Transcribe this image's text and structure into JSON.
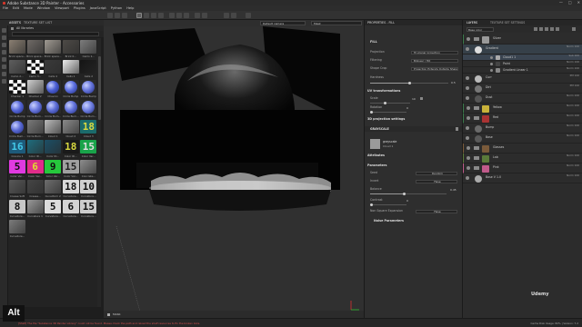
{
  "window": {
    "title": "Adobe Substance 3D Painter - Accessories",
    "controls": [
      "—",
      "□",
      "✕"
    ]
  },
  "menu": [
    "File",
    "Edit",
    "Mode",
    "Window",
    "Viewport",
    "Plugins",
    "JavaScript",
    "Python",
    "Help"
  ],
  "shelf": {
    "tabs": [
      "ASSETS",
      "TEXTURE SET LIST"
    ],
    "library": "All libraries",
    "items": [
      {
        "label": "Brick space...",
        "kind": "mat",
        "bg": "#8a7f72"
      },
      {
        "label": "Brick space...",
        "kind": "mat",
        "bg": "#6f6a66"
      },
      {
        "label": "Brick space...",
        "kind": "mat",
        "bg": "#a09a92"
      },
      {
        "label": "Brick 0...",
        "kind": "mat",
        "bg": "#4d4a46"
      },
      {
        "label": "Camo 1...",
        "kind": "mat",
        "bg": "#7d7d7d"
      },
      {
        "label": "Camo 2...",
        "kind": "mat",
        "bg": "#5e5e5e"
      },
      {
        "label": "Camo 3...",
        "kind": "checker",
        "bg": "#ffffff"
      },
      {
        "label": "Cells 4",
        "kind": "mat",
        "bg": "#3a3a3a"
      },
      {
        "label": "Cells 1",
        "kind": "mat",
        "bg": "#ededed"
      },
      {
        "label": "Cells 2",
        "kind": "mat",
        "bg": "#151515"
      },
      {
        "label": "Checker 1",
        "kind": "checker",
        "bg": "#ffffff"
      },
      {
        "label": "Checker 2",
        "kind": "mat",
        "bg": "#cfcfcf"
      },
      {
        "label": "Chevron",
        "kind": "ball",
        "bg": "#4b5fd4"
      },
      {
        "label": "Circle Bump",
        "kind": "ball",
        "bg": "#5c6fe0"
      },
      {
        "label": "Circle Bump",
        "kind": "ball",
        "bg": "#6675dc"
      },
      {
        "label": "Circle Bump",
        "kind": "ball",
        "bg": "#5667d8"
      },
      {
        "label": "Circle Bum...",
        "kind": "ball",
        "bg": "#6a78de"
      },
      {
        "label": "Circle Bum...",
        "kind": "ball",
        "bg": "#5e6ed6"
      },
      {
        "label": "Circle Bum...",
        "kind": "ball",
        "bg": "#6474dc"
      },
      {
        "label": "Circle Bum...",
        "kind": "ball",
        "bg": "#7080e2"
      },
      {
        "label": "Circle Bum...",
        "kind": "ball",
        "bg": "#5a6ad4"
      },
      {
        "label": "Circle Bum...",
        "kind": "mat",
        "bg": "#7a7a7a"
      },
      {
        "label": "Cloud 1",
        "kind": "mat",
        "bg": "#bbbbbb"
      },
      {
        "label": "Cloud 2",
        "kind": "mat",
        "bg": "#8b8b8b"
      },
      {
        "label": "Cloud 3",
        "kind": "num",
        "bg": "#1b6b6b",
        "num": "18",
        "fg": "#d9d940"
      },
      {
        "label": "Crevice 1",
        "kind": "num",
        "bg": "#1d5a7a",
        "num": "16",
        "fg": "#42c8e8"
      },
      {
        "label": "Color ID...",
        "kind": "mat",
        "bg": "#1f6d7f"
      },
      {
        "label": "Color ID...",
        "kind": "mat",
        "bg": "#1c4f66"
      },
      {
        "label": "Color ID...",
        "kind": "num",
        "bg": "#1a1a1a",
        "num": "18",
        "fg": "#d9d940"
      },
      {
        "label": "Color Var...",
        "kind": "num",
        "bg": "#19a34a",
        "num": "15",
        "fg": "#e0e0e0"
      },
      {
        "label": "Color Var...",
        "kind": "num",
        "bg": "#e03ae0",
        "num": "5",
        "fg": "#111111"
      },
      {
        "label": "Color Var...",
        "kind": "num",
        "bg": "#e02c8a",
        "num": "6",
        "fg": "#dddd30"
      },
      {
        "label": "Color Var...",
        "kind": "num",
        "bg": "#26c83c",
        "num": "9",
        "fg": "#111111"
      },
      {
        "label": "Color Var...",
        "kind": "num",
        "bg": "#a0a0a0",
        "num": "15",
        "fg": "#222222"
      },
      {
        "label": "Concrete...",
        "kind": "mat",
        "bg": "#8e8e8e"
      },
      {
        "label": "Crease Soft",
        "kind": "mat",
        "bg": "#585858"
      },
      {
        "label": "Crease...",
        "kind": "mat",
        "bg": "#454545"
      },
      {
        "label": "Cuneiform 2",
        "kind": "mat",
        "bg": "#6e6e6e"
      },
      {
        "label": "Curvature...",
        "kind": "num",
        "bg": "#d8d8d8",
        "num": "18",
        "fg": "#111111"
      },
      {
        "label": "Curvature...",
        "kind": "num",
        "bg": "#d0d0d0",
        "num": "10",
        "fg": "#111111"
      },
      {
        "label": "Curvature...",
        "kind": "num",
        "bg": "#c8c8c8",
        "num": "8",
        "fg": "#111111"
      },
      {
        "label": "Curvature 1",
        "kind": "mat",
        "bg": "#9a9a9a"
      },
      {
        "label": "Curvature...",
        "kind": "num",
        "bg": "#dcdcdc",
        "num": "5",
        "fg": "#111111"
      },
      {
        "label": "Curvature...",
        "kind": "num",
        "bg": "#d4d4d4",
        "num": "6",
        "fg": "#111111"
      },
      {
        "label": "Curvature...",
        "kind": "num",
        "bg": "#cccccc",
        "num": "15",
        "fg": "#111111"
      },
      {
        "label": "Curvature...",
        "kind": "mat",
        "bg": "#7c7c7c"
      }
    ]
  },
  "viewport": {
    "camera": "Default camera",
    "mode": "Mask",
    "bottom_label": "MASK"
  },
  "properties": {
    "title": "PROPERTIES - FILL",
    "fill_header": "FILL",
    "rows": [
      {
        "label": "Projection",
        "value": "Tri-planar projection"
      },
      {
        "label": "Filtering",
        "value": "Bilinear | HQ"
      },
      {
        "label": "Shape Crop",
        "value": "Projection Extends Outside Shape"
      }
    ],
    "hardness_label": "Hardness",
    "hardness_value": "0.5",
    "hardness": 0.5,
    "uv_header": "UV transformations",
    "scale_label": "Scale",
    "scale_value": "10",
    "rotation_label": "Rotation",
    "rotation_value": "0",
    "proj3d_header": "3D projection settings",
    "grayscale_header": "GRAYSCALE",
    "grayscale_name": "grayscale",
    "grayscale_res": "Cloud 1",
    "attributes_header": "Attributes",
    "parameters_header": "Parameters",
    "params": [
      {
        "label": "Seed",
        "value": "Random"
      },
      {
        "label": "Invert",
        "value": "False"
      }
    ],
    "balance_label": "Balance",
    "balance_value": "0.45",
    "balance": 0.45,
    "contrast_label": "Contrast",
    "contrast_value": "0",
    "nonsquare_label": "Non Square Expansion",
    "nonsquare_value": "False",
    "noise_header": "Noise Parameters"
  },
  "layers": {
    "tabs": [
      "LAYERS",
      "TEXTURE SET SETTINGS"
    ],
    "channel": "Base color",
    "rows": [
      {
        "name": "Silver",
        "blend": "",
        "thumb": "#999999",
        "kind": "folder",
        "color": "#3a7a4a"
      },
      {
        "name": "Gradient",
        "blend": "Norm  100",
        "thumb": "#dddddd",
        "kind": "layer",
        "selected": true
      },
      {
        "name": "Cloud1 1",
        "blend": "Sub  100",
        "thumb": "#aaaaaa",
        "kind": "sub",
        "selected": true
      },
      {
        "name": "Paint",
        "blend": "Norm  100",
        "thumb": "#444444",
        "kind": "sub"
      },
      {
        "name": "Gradient Linear 1",
        "blend": "Norm  100",
        "thumb": "#888888",
        "kind": "sub"
      },
      {
        "name": "Curr",
        "blend": "PM  100",
        "thumb": "#bbbbbb",
        "kind": "layer"
      },
      {
        "name": "Dirt",
        "blend": "PM  100",
        "thumb": "#777777",
        "kind": "layer"
      },
      {
        "name": "Dust",
        "blend": "Norm  100",
        "thumb": "#555555",
        "kind": "layer"
      },
      {
        "name": "Yellow",
        "blend": "Norm  100",
        "thumb": "#c9b23a",
        "kind": "folder",
        "color": "#3a7a4a"
      },
      {
        "name": "Red",
        "blend": "Norm  100",
        "thumb": "#aa3333",
        "kind": "folder",
        "color": "#3a7a4a"
      },
      {
        "name": "Bump",
        "blend": "Norm  100",
        "thumb": "#6a6a6a",
        "kind": "layer"
      },
      {
        "name": "Base",
        "blend": "Norm  100",
        "thumb": "#5a5a5a",
        "kind": "layer"
      },
      {
        "name": "Glasses",
        "blend": "",
        "thumb": "#7a5a3a",
        "kind": "folder",
        "color": "#7a5a3a"
      },
      {
        "name": "Lab",
        "blend": "Norm  100",
        "thumb": "#5a7a3a",
        "kind": "folder",
        "color": "#5a7a3a"
      },
      {
        "name": "Pink",
        "blend": "Norm  100",
        "thumb": "#c05a8a",
        "kind": "folder",
        "color": "#c05a8a"
      },
      {
        "name": "Base V 1.0",
        "blend": "Norm  100",
        "thumb": "#aaaaaa",
        "kind": "layer"
      }
    ]
  },
  "status": {
    "left": "[Shelf] The file \"Substance 3D Painter Library\" could not be found. Please check the path and reload the shelf resources to fix the broken links.",
    "right": "Cache Disk Usage: 82% | Version: 7.2"
  },
  "badge": "Alt",
  "watermark": "Udemy"
}
